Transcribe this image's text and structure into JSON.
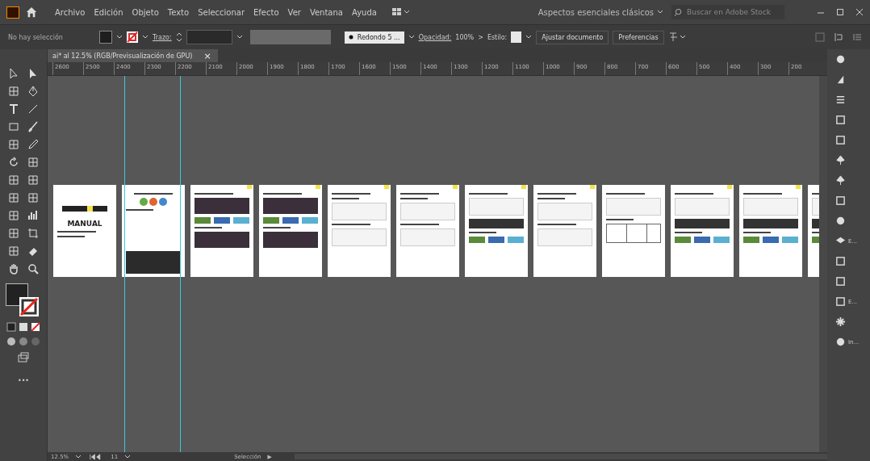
{
  "app": {
    "menu": [
      "Archivo",
      "Edición",
      "Objeto",
      "Texto",
      "Seleccionar",
      "Efecto",
      "Ver",
      "Ventana",
      "Ayuda"
    ],
    "workspace": "Aspectos esenciales clásicos",
    "search": {
      "placeholder": "Buscar en Adobe Stock"
    }
  },
  "control_bar": {
    "selection": "No hay selección",
    "stroke_label": "Trazo:",
    "brush": "Redondo 5 ...",
    "opacity_label": "Opacidad:",
    "opacity": "100%",
    "more": ">",
    "style_label": "Estilo:",
    "buttons": [
      "Ajustar documento",
      "Preferencias"
    ]
  },
  "document_tab": {
    "title": "ai* al 12.5% (RGB/Previsualización de GPU)",
    "close": "×"
  },
  "ruler": [
    "2600",
    "2500",
    "2400",
    "2300",
    "2200",
    "2100",
    "2000",
    "1900",
    "1800",
    "1700",
    "1600",
    "1500",
    "1400",
    "1300",
    "1200",
    "1100",
    "1000",
    "900",
    "800",
    "700",
    "600",
    "500",
    "400",
    "300",
    "200"
  ],
  "artboards": [
    {
      "kind": "cover",
      "title": "MANUAL"
    },
    {
      "kind": "circles"
    },
    {
      "kind": "photo"
    },
    {
      "kind": "photo"
    },
    {
      "kind": "form"
    },
    {
      "kind": "form"
    },
    {
      "kind": "gallery"
    },
    {
      "kind": "form"
    },
    {
      "kind": "table"
    },
    {
      "kind": "gallery"
    },
    {
      "kind": "gallery"
    },
    {
      "kind": "gallery"
    }
  ],
  "right_panel": [
    {
      "kind": "icon"
    },
    {
      "kind": "icon"
    },
    {
      "kind": "icon"
    },
    {
      "kind": "icon"
    },
    {
      "kind": "icon"
    },
    {
      "kind": "icon"
    },
    {
      "kind": "icon"
    },
    {
      "kind": "icon"
    },
    {
      "kind": "icon"
    },
    {
      "kind": "labeled",
      "label": "E..."
    },
    {
      "kind": "icon"
    },
    {
      "kind": "icon"
    },
    {
      "kind": "labeled",
      "label": "E..."
    },
    {
      "kind": "icon"
    },
    {
      "kind": "labeled",
      "label": "In..."
    }
  ],
  "toolbar": {
    "more": "•••"
  },
  "status_bar": {
    "zoom": "12.5%",
    "artboard": "11",
    "tool": "Selección",
    "play": "▶"
  }
}
